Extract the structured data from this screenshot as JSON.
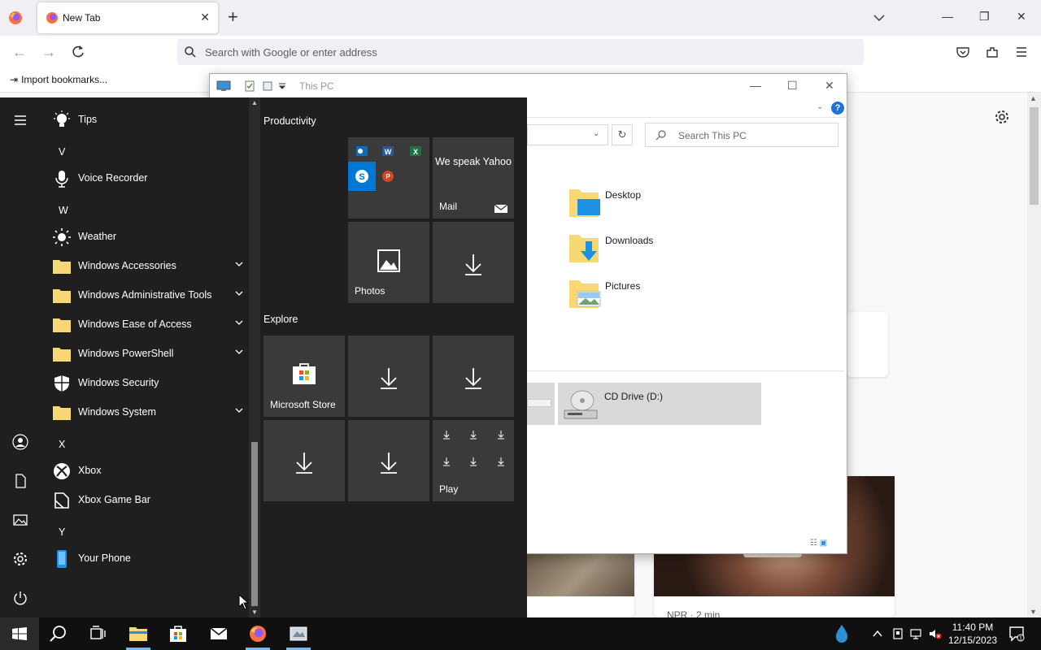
{
  "browser": {
    "tab_title": "New Tab",
    "url_placeholder": "Search with Google or enter address",
    "bookmark_import": "Import bookmarks...",
    "story_source": "NPR · 2 min"
  },
  "explorer": {
    "title": "This PC",
    "search_placeholder": "Search This PC",
    "folders": [
      "Desktop",
      "Downloads",
      "Pictures"
    ],
    "drive_label": "CD Drive (D:)"
  },
  "start_menu": {
    "apps": {
      "tips": "Tips",
      "letter_v": "V",
      "voice_recorder": "Voice Recorder",
      "letter_w": "W",
      "weather": "Weather",
      "win_accessories": "Windows Accessories",
      "win_admin_tools": "Windows Administrative Tools",
      "win_ease_access": "Windows Ease of Access",
      "win_powershell": "Windows PowerShell",
      "win_security": "Windows Security",
      "win_system": "Windows System",
      "letter_x": "X",
      "xbox": "Xbox",
      "xbox_game_bar": "Xbox Game Bar",
      "letter_y": "Y",
      "your_phone": "Your Phone"
    },
    "groups": {
      "productivity": "Productivity",
      "explore": "Explore"
    },
    "tiles": {
      "mail_promo": "We speak Yahoo",
      "mail": "Mail",
      "photos": "Photos",
      "store": "Microsoft Store",
      "play": "Play"
    }
  },
  "taskbar": {
    "time": "11:40 PM",
    "date": "12/15/2023"
  },
  "colors": {
    "start_bg": "#1f1f1f",
    "tile_bg": "#3a3a3a",
    "taskbar_bg": "#101010",
    "accent_blue": "#0078d7",
    "folder_yellow": "#f8d775"
  }
}
